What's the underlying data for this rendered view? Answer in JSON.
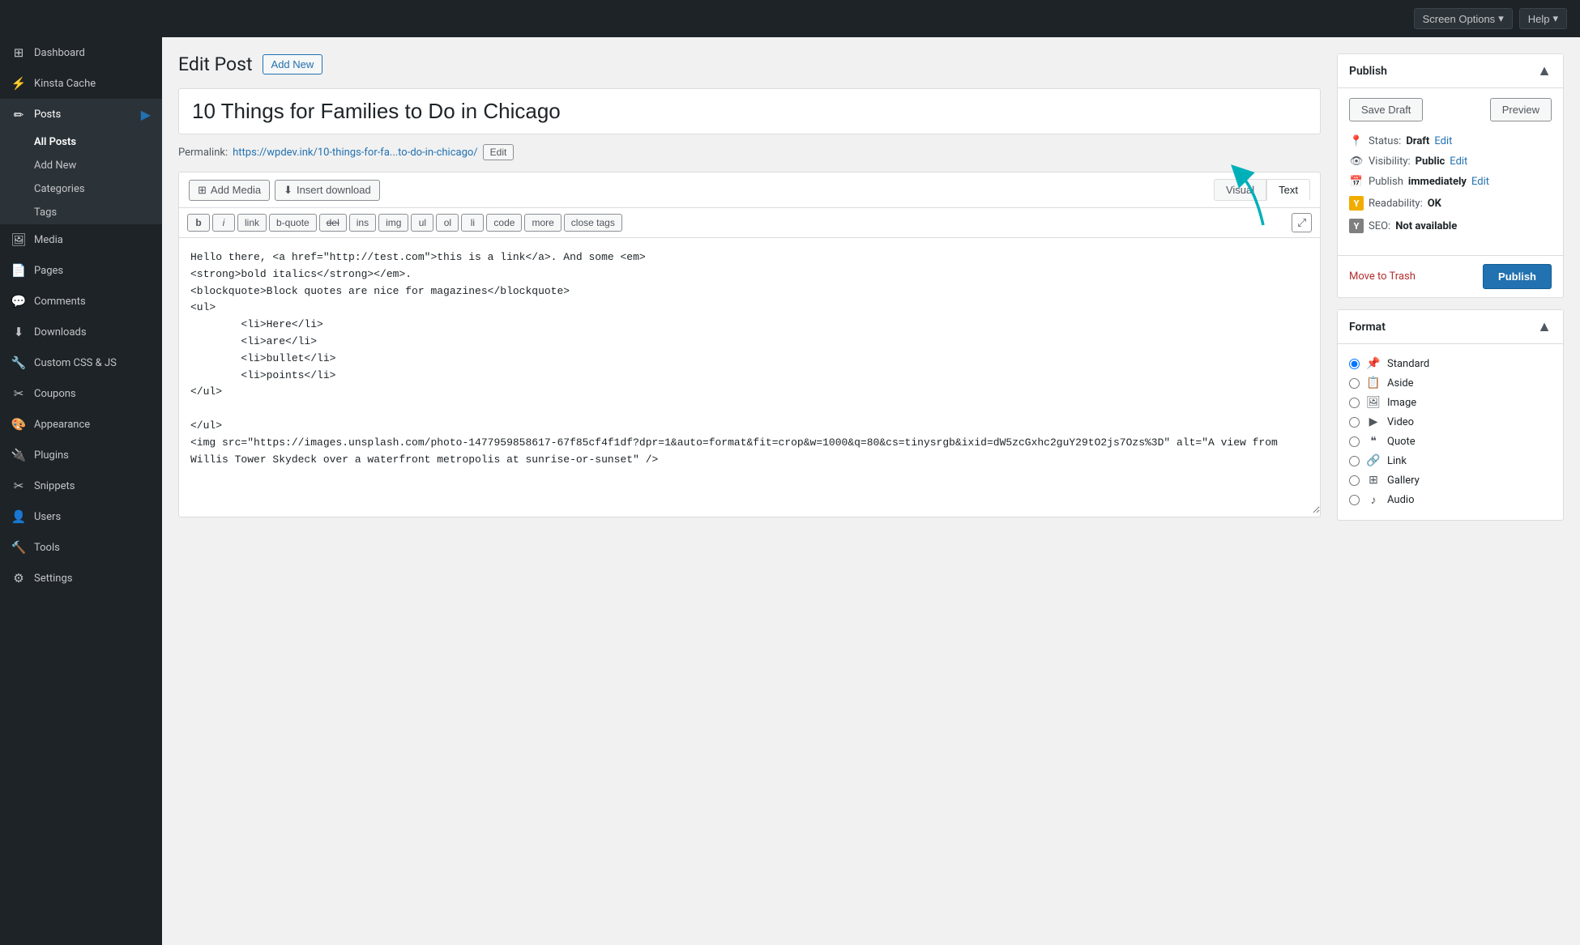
{
  "topbar": {
    "screen_options_label": "Screen Options",
    "help_label": "Help"
  },
  "sidebar": {
    "items": [
      {
        "id": "dashboard",
        "label": "Dashboard",
        "icon": "⊞"
      },
      {
        "id": "kinsta-cache",
        "label": "Kinsta Cache",
        "icon": "⚡"
      },
      {
        "id": "posts",
        "label": "Posts",
        "icon": "📝",
        "active": true
      },
      {
        "id": "media",
        "label": "Media",
        "icon": "🖼"
      },
      {
        "id": "pages",
        "label": "Pages",
        "icon": "📄"
      },
      {
        "id": "comments",
        "label": "Comments",
        "icon": "💬"
      },
      {
        "id": "downloads",
        "label": "Downloads",
        "icon": "⬇"
      },
      {
        "id": "custom-css-js",
        "label": "Custom CSS & JS",
        "icon": "🔧"
      },
      {
        "id": "coupons",
        "label": "Coupons",
        "icon": "✂"
      },
      {
        "id": "appearance",
        "label": "Appearance",
        "icon": "🎨"
      },
      {
        "id": "plugins",
        "label": "Plugins",
        "icon": "🔌"
      },
      {
        "id": "snippets",
        "label": "Snippets",
        "icon": "✂"
      },
      {
        "id": "users",
        "label": "Users",
        "icon": "👤"
      },
      {
        "id": "tools",
        "label": "Tools",
        "icon": "🔨"
      },
      {
        "id": "settings",
        "label": "Settings",
        "icon": "⚙"
      }
    ],
    "sub_items": [
      {
        "id": "all-posts",
        "label": "All Posts",
        "active": true
      },
      {
        "id": "add-new",
        "label": "Add New"
      },
      {
        "id": "categories",
        "label": "Categories"
      },
      {
        "id": "tags",
        "label": "Tags"
      }
    ]
  },
  "page": {
    "title": "Edit Post",
    "add_new_label": "Add New"
  },
  "post": {
    "title": "10 Things for Families to Do in Chicago",
    "permalink_label": "Permalink:",
    "permalink_url": "https://wpdev.ink/10-things-for-fa...to-do-in-chicago/",
    "edit_label": "Edit"
  },
  "editor": {
    "add_media_label": "Add Media",
    "insert_download_label": "Insert download",
    "visual_tab": "Visual",
    "text_tab": "Text",
    "format_buttons": [
      "b",
      "i",
      "link",
      "b-quote",
      "del",
      "ins",
      "img",
      "ul",
      "ol",
      "li",
      "code",
      "more",
      "close tags"
    ],
    "content": "Hello there, <a href=\"http://test.com\">this is a link</a>. And some <em>\n<strong>bold italics</strong></em>.\n<blockquote>Block quotes are nice for magazines</blockquote>\n<ul>\n        <li>Here</li>\n        <li>are</li>\n        <li>bullet</li>\n        <li>points</li>\n</ul>\n\n</ul>\n<img src=\"https://images.unsplash.com/photo-1477959858617-67f85cf4f1df?dpr=1&amp;auto=format&amp;fit=crop&amp;w=1000&amp;q=80&amp;cs=tinysrgb&amp;ixid=dW5zcGxhc2guY29tO2js7Ozs%3D\" alt=\"A view from Willis Tower Skydeck over a waterfront metropolis at sunrise-or-sunset\" />"
  },
  "publish_box": {
    "title": "Publish",
    "save_draft_label": "Save Draft",
    "preview_label": "Preview",
    "status_label": "Status:",
    "status_value": "Draft",
    "status_edit": "Edit",
    "visibility_label": "Visibility:",
    "visibility_value": "Public",
    "visibility_edit": "Edit",
    "publish_label": "Publish",
    "publish_edit": "Edit",
    "publish_when": "immediately",
    "readability_label": "Readability:",
    "readability_value": "OK",
    "seo_label": "SEO:",
    "seo_value": "Not available",
    "move_trash_label": "Move to Trash",
    "publish_button": "Publish"
  },
  "format_box": {
    "title": "Format",
    "options": [
      {
        "id": "standard",
        "label": "Standard",
        "icon": "📌",
        "checked": true
      },
      {
        "id": "aside",
        "label": "Aside",
        "icon": "📋",
        "checked": false
      },
      {
        "id": "image",
        "label": "Image",
        "icon": "🖼",
        "checked": false
      },
      {
        "id": "video",
        "label": "Video",
        "icon": "▶",
        "checked": false
      },
      {
        "id": "quote",
        "label": "Quote",
        "icon": "❝",
        "checked": false
      },
      {
        "id": "link",
        "label": "Link",
        "icon": "🔗",
        "checked": false
      },
      {
        "id": "gallery",
        "label": "Gallery",
        "icon": "⊞",
        "checked": false
      },
      {
        "id": "audio",
        "label": "Audio",
        "icon": "♪",
        "checked": false
      }
    ]
  }
}
